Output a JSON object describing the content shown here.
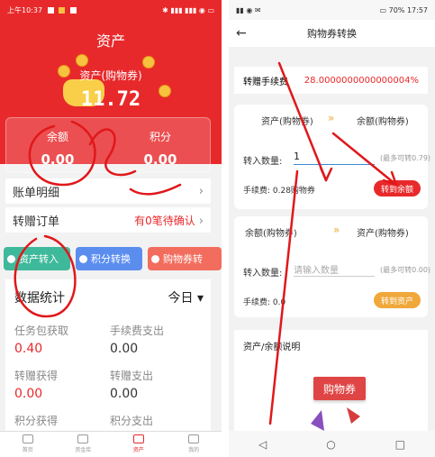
{
  "left": {
    "status": {
      "time": "上午10:37"
    },
    "title": "资产",
    "asset_label": "资产(购物券)",
    "asset_value": "11.72",
    "balance_label": "余额",
    "balance_value": "0.00",
    "points_label": "积分",
    "points_value": "0.00",
    "rows": [
      {
        "label": "账单明细",
        "right": ""
      },
      {
        "label": "转赠订单",
        "right": "有0笔待确认"
      }
    ],
    "buttons": [
      {
        "label": "资产转入",
        "color": "#3fb99b"
      },
      {
        "label": "积分转换",
        "color": "#5b8def"
      },
      {
        "label": "购物券转",
        "color": "#f26d5e"
      }
    ],
    "stats_title": "数据统计",
    "stats_period": "今日",
    "stats": [
      {
        "label": "任务包获取",
        "value": "0.40",
        "highlight": true
      },
      {
        "label": "手续费支出",
        "value": "0.00",
        "highlight": false
      },
      {
        "label": "转赠获得",
        "value": "0.00",
        "highlight": true
      },
      {
        "label": "转赠支出",
        "value": "0.00",
        "highlight": false
      },
      {
        "label": "积分获得",
        "value": "",
        "highlight": false
      },
      {
        "label": "积分支出",
        "value": "",
        "highlight": false
      }
    ],
    "nav": [
      {
        "label": "首页",
        "active": false
      },
      {
        "label": "资金库",
        "active": false
      },
      {
        "label": "资产",
        "active": true
      },
      {
        "label": "我的",
        "active": false
      }
    ],
    "accent": "#e8292b"
  },
  "right": {
    "status": {
      "battery": "70%",
      "time": "17:57"
    },
    "title": "购物券转换",
    "fee_label": "转赠手续费",
    "fee_value": "28.0000000000000004%",
    "box1": {
      "from": "资产(购物券)",
      "to": "余额(购物券)",
      "input_label": "转入数量:",
      "input_value": "1",
      "hint": "(最多可转0.79)",
      "fee_text": "手续费: 0.28购物券",
      "button": "转到余额"
    },
    "box2": {
      "from": "余额(购物券)",
      "to": "资产(购物券)",
      "input_label": "转入数量:",
      "placeholder": "请输入数量",
      "hint": "(最多可转0.00)",
      "fee_text": "手续费: 0.0",
      "button": "转到资产"
    },
    "desc_title": "资产/余额说明",
    "banner": "购物券",
    "sys_nav": [
      "◁",
      "○",
      "□"
    ]
  }
}
